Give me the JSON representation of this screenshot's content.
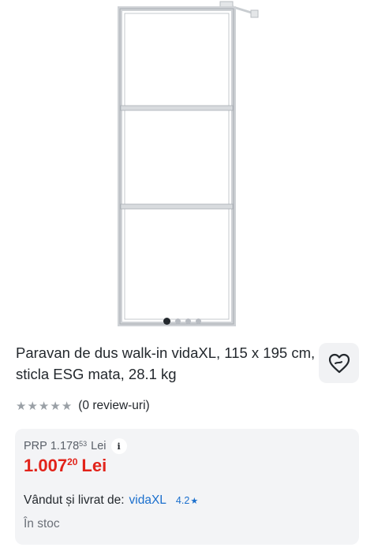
{
  "gallery": {
    "image_alt": "Paravan de dus walk-in vidaXL",
    "dots_total": 4,
    "active_dot": 1
  },
  "product": {
    "title": "Paravan de dus walk-in vidaXL, 115 x 195 cm, sticla ESG mata, 28.1 kg",
    "favorite_icon": "heart-icon"
  },
  "rating": {
    "stars": 5,
    "filled": 0,
    "star_color": "#9aa0a6",
    "reviews_text": "(0 review-uri)"
  },
  "pricing": {
    "prp_label": "PRP",
    "prp_main": "1.178",
    "prp_decimals": "53",
    "prp_currency": "Lei",
    "info_icon": "i",
    "price_main": "1.007",
    "price_decimals": "20",
    "price_currency": "Lei",
    "price_color": "#e2231a"
  },
  "seller": {
    "label": "Vândut și livrat de:",
    "name": "vidaXL",
    "rating": "4.2",
    "rating_icon": "★",
    "link_color": "#1a6fcd"
  },
  "availability": {
    "text": "În stoc"
  }
}
